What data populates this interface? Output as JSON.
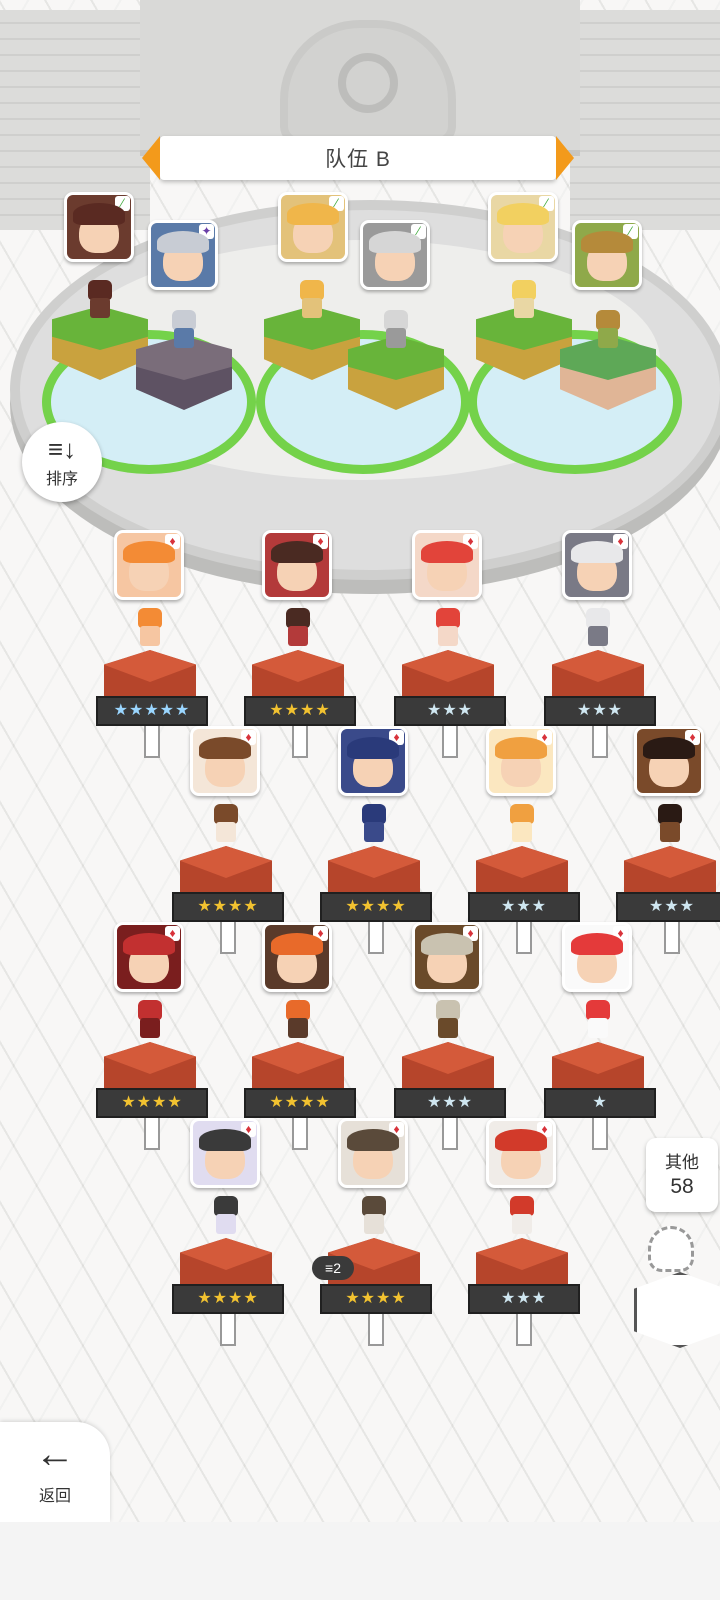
{
  "header": {
    "team_title": "队伍 B"
  },
  "controls": {
    "sort_label": "排序",
    "back_label": "返回"
  },
  "other": {
    "label": "其他",
    "count": "58"
  },
  "stack_badge": "2",
  "team_slots": [
    {
      "badge": "leaf",
      "hair": "#5a2a22",
      "bg": "#6b3b2e",
      "block": "grass"
    },
    {
      "badge": "star",
      "hair": "#c8ccd4",
      "bg": "#5a7aa8",
      "block": "stone"
    },
    {
      "badge": "leaf",
      "hair": "#f0b64a",
      "bg": "#e3c27a",
      "block": "grass"
    },
    {
      "badge": "leaf",
      "hair": "#d6d6d6",
      "bg": "#9a9a9a",
      "block": "grass"
    },
    {
      "badge": "leaf",
      "hair": "#f2d060",
      "bg": "#e9d7a4",
      "block": "grass"
    },
    {
      "badge": "leaf",
      "hair": "#b58a3a",
      "bg": "#8fa94a",
      "block": "pink"
    }
  ],
  "roster": [
    {
      "stars": "★★★★★",
      "tier": "rainbow",
      "hair": "#f38b35",
      "bg": "#f6c6a2"
    },
    {
      "stars": "★★★★",
      "tier": "gold",
      "hair": "#4a2a22",
      "bg": "#b33a3a"
    },
    {
      "stars": "★★★",
      "tier": "silver",
      "hair": "#e2443a",
      "bg": "#f4d8c8"
    },
    {
      "stars": "★★★",
      "tier": "silver",
      "hair": "#e8e8ea",
      "bg": "#7a7a86"
    },
    {
      "stars": "★★★★",
      "tier": "gold",
      "hair": "#7a4a2a",
      "bg": "#f4e6d8"
    },
    {
      "stars": "★★★★",
      "tier": "gold",
      "hair": "#2a3a7a",
      "bg": "#3a4a8a"
    },
    {
      "stars": "★★★",
      "tier": "silver",
      "hair": "#f0a040",
      "bg": "#fbe7c0"
    },
    {
      "stars": "★★★",
      "tier": "silver",
      "hair": "#2a1a14",
      "bg": "#7a4a2a"
    },
    {
      "stars": "★★★★",
      "tier": "gold",
      "hair": "#c23030",
      "bg": "#7a1e1e"
    },
    {
      "stars": "★★★★",
      "tier": "gold",
      "hair": "#e86a2a",
      "bg": "#5a3a2a"
    },
    {
      "stars": "★★★",
      "tier": "silver",
      "hair": "#c9c2b0",
      "bg": "#6a4a2a"
    },
    {
      "stars": "★",
      "tier": "silver",
      "hair": "#e43a3a",
      "bg": "#fafafa"
    },
    {
      "stars": "★★★★",
      "tier": "gold",
      "hair": "#3a3a3a",
      "bg": "#e0dcf0"
    },
    {
      "stars": "★★★★",
      "tier": "gold",
      "hair": "#5a4a3a",
      "bg": "#e6e0d8"
    },
    {
      "stars": "★★★",
      "tier": "silver",
      "hair": "#d23a2a",
      "bg": "#f0ece8"
    }
  ]
}
